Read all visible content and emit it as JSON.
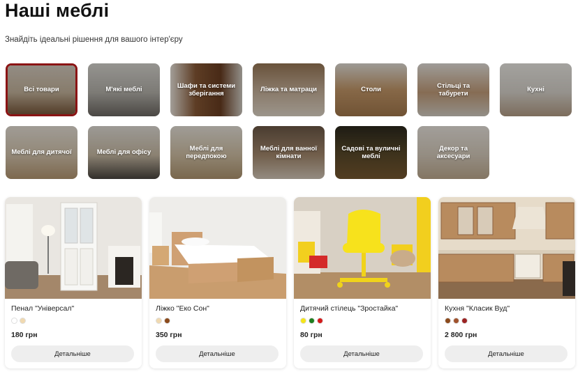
{
  "page": {
    "title": "Наші меблі",
    "subtitle": "Знайдіть ідеальні рішення для вашого інтер'єру"
  },
  "categories": [
    {
      "label": "Всі товари",
      "active": true
    },
    {
      "label": "М'які меблі",
      "active": false
    },
    {
      "label": "Шафи та системи зберігання",
      "active": false
    },
    {
      "label": "Ліжка та матраци",
      "active": false
    },
    {
      "label": "Столи",
      "active": false
    },
    {
      "label": "Стільці та табурети",
      "active": false
    },
    {
      "label": "Кухні",
      "active": false
    },
    {
      "label": "Меблі для дитячої",
      "active": false
    },
    {
      "label": "Меблі для офісу",
      "active": false
    },
    {
      "label": "Меблі для передпокою",
      "active": false
    },
    {
      "label": "Меблі для ванної кімнати",
      "active": false
    },
    {
      "label": "Садові та вуличні меблі",
      "active": false
    },
    {
      "label": "Декор та аксесуари",
      "active": false
    }
  ],
  "products": [
    {
      "name": "Пенал \"Універсал\"",
      "price": "180 грн",
      "button": "Детальніше",
      "colors": [
        "#ffffff",
        "#f0d9b0"
      ]
    },
    {
      "name": "Ліжко \"Еко Сон\"",
      "price": "350 грн",
      "button": "Детальніше",
      "colors": [
        "#f0d9b0",
        "#8b4a1c"
      ]
    },
    {
      "name": "Дитячий стілець \"Зростайка\"",
      "price": "80 грн",
      "button": "Детальніше",
      "colors": [
        "#f5e51a",
        "#1e7d1e",
        "#d31a1a"
      ]
    },
    {
      "name": "Кухня \"Класик Вуд\"",
      "price": "2 800 грн",
      "button": "Детальніше",
      "colors": [
        "#8b4a1c",
        "#a0522d",
        "#9b2222"
      ]
    }
  ],
  "accent_color": "#8b1414"
}
